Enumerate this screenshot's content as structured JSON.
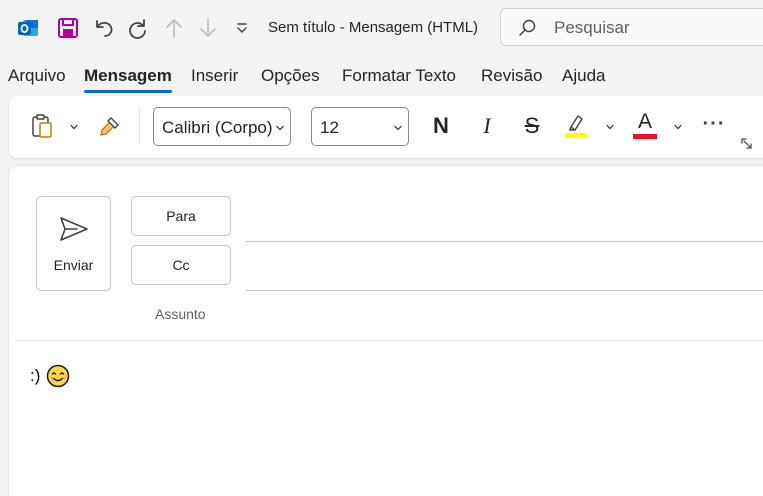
{
  "title_bar": {
    "window_title": "Sem título  -  Mensagem (HTML)",
    "search_placeholder": "Pesquisar",
    "icons": [
      "outlook-app-icon",
      "save-icon",
      "undo-icon",
      "redo-icon",
      "arrow-up-icon",
      "arrow-down-icon",
      "customize-qat-icon",
      "search-icon"
    ]
  },
  "tabs": [
    {
      "label": "Arquivo",
      "active": false
    },
    {
      "label": "Mensagem",
      "active": true
    },
    {
      "label": "Inserir",
      "active": false
    },
    {
      "label": "Opções",
      "active": false
    },
    {
      "label": "Formatar Texto",
      "active": false
    },
    {
      "label": "Revisão",
      "active": false
    },
    {
      "label": "Ajuda",
      "active": false
    }
  ],
  "ribbon": {
    "font_name": "Calibri (Corpo)",
    "font_size": "12",
    "bold_glyph": "N",
    "italic_glyph": "I",
    "strike_glyph": "S",
    "highlight_color": "#ffff00",
    "font_color_glyph": "A",
    "font_color": "#e81123",
    "more_glyph": "···"
  },
  "compose": {
    "send_label": "Enviar",
    "to_label": "Para",
    "cc_label": "Cc",
    "subject_label": "Assunto",
    "to_value": "",
    "cc_value": "",
    "body_text": ":)"
  },
  "colors": {
    "accent": "#0f6cbd",
    "app_purple": "#a4373a",
    "save_magenta": "#b4009e"
  }
}
